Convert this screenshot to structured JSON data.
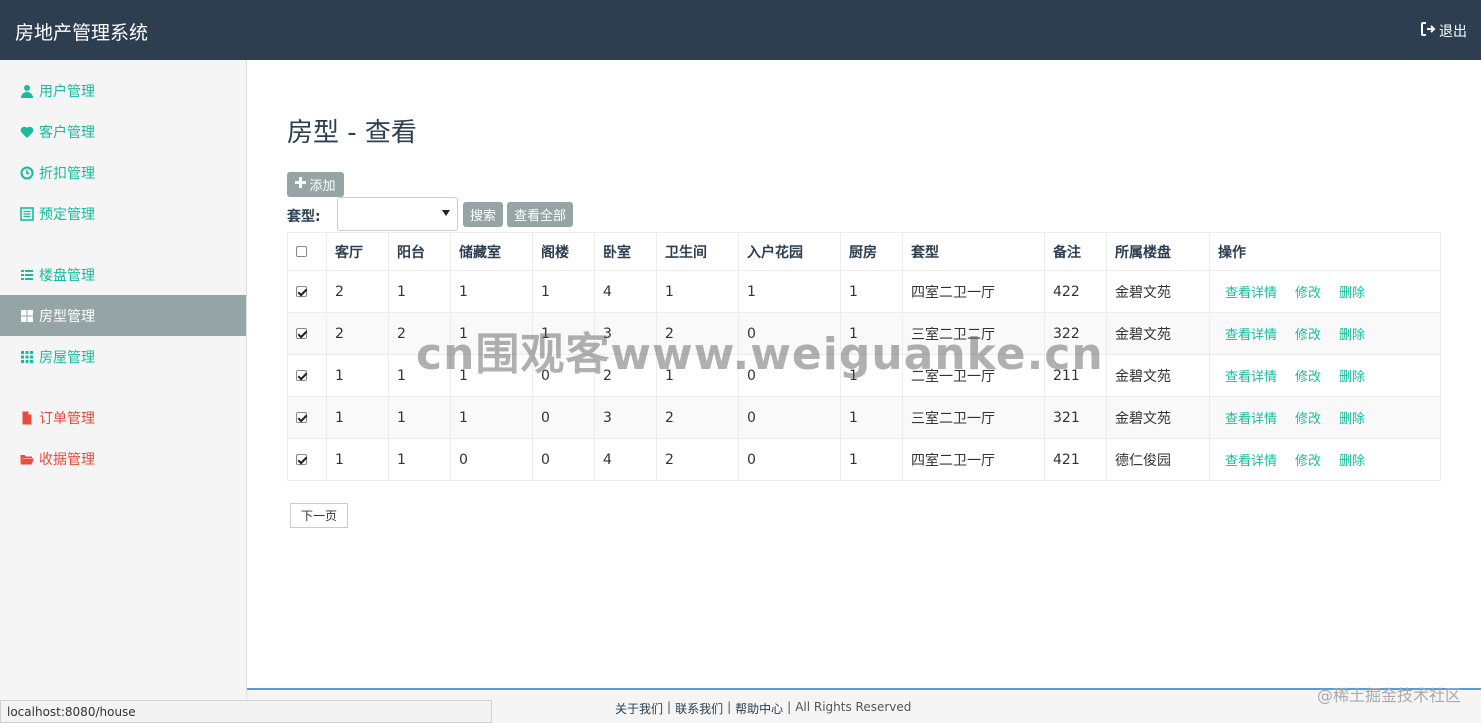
{
  "header": {
    "title": "房地产管理系统",
    "logout_label": "退出"
  },
  "sidebar": {
    "items": [
      {
        "label": "用户管理",
        "icon": "user-icon"
      },
      {
        "label": "客户管理",
        "icon": "heart-icon"
      },
      {
        "label": "折扣管理",
        "icon": "clock-icon"
      },
      {
        "label": "预定管理",
        "icon": "list-alt-icon"
      },
      {
        "label": "楼盘管理",
        "icon": "list-icon"
      },
      {
        "label": "房型管理",
        "icon": "grid-large-icon"
      },
      {
        "label": "房屋管理",
        "icon": "grid-small-icon"
      },
      {
        "label": "订单管理",
        "icon": "file-icon"
      },
      {
        "label": "收据管理",
        "icon": "folder-open-icon"
      }
    ]
  },
  "main": {
    "title": "房型 - 查看",
    "add_label": "添加",
    "filter_label": "套型:",
    "filter_value": "",
    "search_label": "搜索",
    "view_all_label": "查看全部",
    "next_page_label": "下一页"
  },
  "table": {
    "headers": [
      "客厅",
      "阳台",
      "储藏室",
      "阁楼",
      "卧室",
      "卫生间",
      "入户花园",
      "厨房",
      "套型",
      "备注",
      "所属楼盘",
      "操作"
    ],
    "rows": [
      {
        "checked": true,
        "cells": [
          "2",
          "1",
          "1",
          "1",
          "4",
          "1",
          "1",
          "1",
          "四室二卫一厅",
          "422",
          "金碧文苑"
        ]
      },
      {
        "checked": true,
        "cells": [
          "2",
          "2",
          "1",
          "1",
          "3",
          "2",
          "0",
          "1",
          "三室二卫二厅",
          "322",
          "金碧文苑"
        ]
      },
      {
        "checked": true,
        "cells": [
          "1",
          "1",
          "1",
          "0",
          "2",
          "1",
          "0",
          "1",
          "二室一卫一厅",
          "211",
          "金碧文苑"
        ]
      },
      {
        "checked": true,
        "cells": [
          "1",
          "1",
          "1",
          "0",
          "3",
          "2",
          "0",
          "1",
          "三室二卫一厅",
          "321",
          "金碧文苑"
        ]
      },
      {
        "checked": true,
        "cells": [
          "1",
          "1",
          "0",
          "0",
          "4",
          "2",
          "0",
          "1",
          "四室二卫一厅",
          "421",
          "德仁俊园"
        ]
      }
    ],
    "actions": [
      "查看详情",
      "修改",
      "删除"
    ]
  },
  "watermark": "cn围观客www.weiguanke.cn",
  "footer": {
    "links": [
      "关于我们",
      "联系我们",
      "帮助中心"
    ],
    "rights": "All Rights Reserved",
    "corner": "@稀土掘金技术社区"
  },
  "statusbar": "localhost:8080/house",
  "colors": {
    "navbar": "#2c3e50",
    "accent": "#18bc9c",
    "danger": "#e74c3c",
    "muted": "#95a5a6"
  }
}
